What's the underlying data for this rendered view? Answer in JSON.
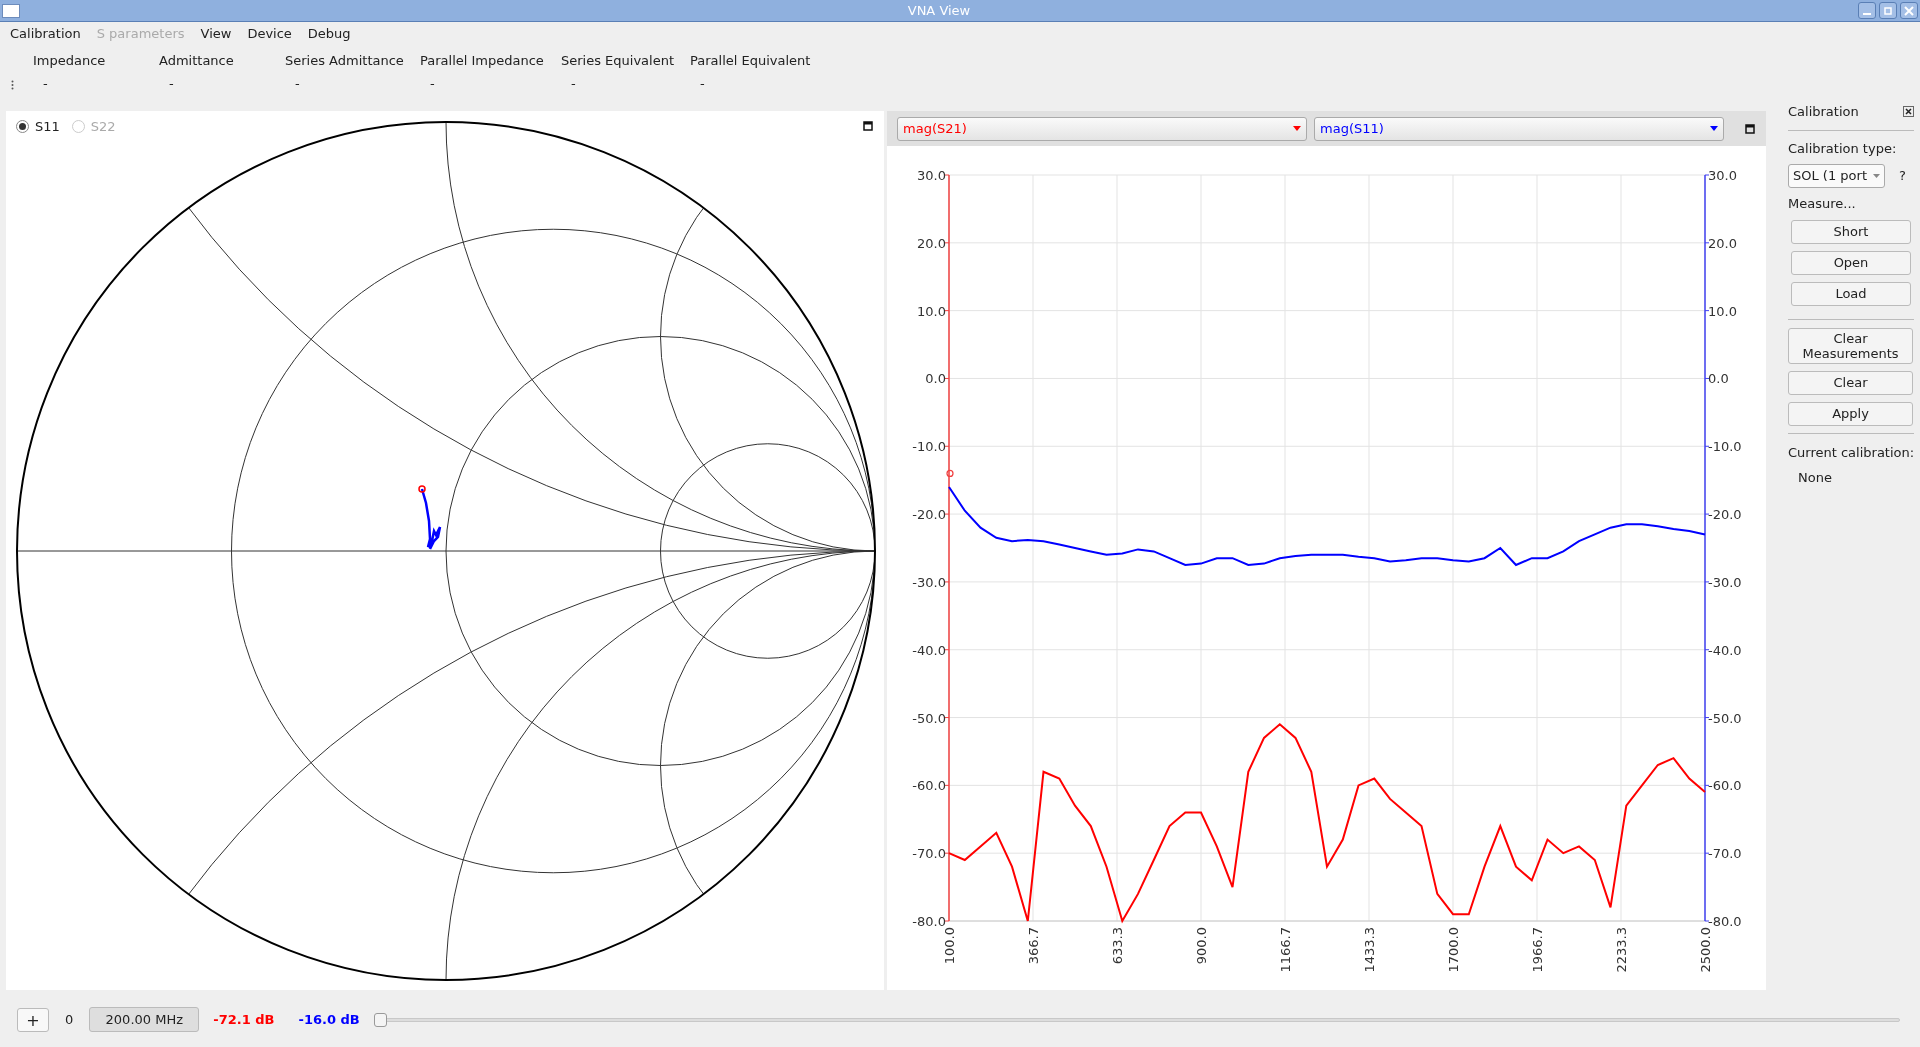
{
  "window": {
    "title": "VNA View"
  },
  "menu": [
    {
      "label": "Calibration",
      "disabled": false
    },
    {
      "label": "S parameters",
      "disabled": true
    },
    {
      "label": "View",
      "disabled": false
    },
    {
      "label": "Device",
      "disabled": false
    },
    {
      "label": "Debug",
      "disabled": false
    }
  ],
  "info_panel": {
    "columns": [
      {
        "heading": "Impedance",
        "value": "-"
      },
      {
        "heading": "Admittance",
        "value": "-"
      },
      {
        "heading": "Series Admittance",
        "value": "-"
      },
      {
        "heading": "Parallel Impedance",
        "value": "-"
      },
      {
        "heading": "Series Equivalent",
        "value": "-"
      },
      {
        "heading": "Parallel Equivalent",
        "value": "-"
      }
    ]
  },
  "smith_chart": {
    "ports": [
      {
        "label": "S11",
        "selected": true,
        "disabled": false
      },
      {
        "label": "S22",
        "selected": false,
        "disabled": true
      }
    ]
  },
  "graph": {
    "chart_data": {
      "type": "line",
      "grid": true,
      "x": [
        100,
        150,
        200,
        250,
        300,
        350,
        400,
        450,
        500,
        550,
        600,
        650,
        700,
        750,
        800,
        850,
        900,
        950,
        1000,
        1050,
        1100,
        1150,
        1200,
        1250,
        1300,
        1350,
        1400,
        1450,
        1500,
        1550,
        1600,
        1650,
        1700,
        1750,
        1800,
        1850,
        1900,
        1950,
        2000,
        2050,
        2100,
        2150,
        2200,
        2250,
        2300,
        2350,
        2400,
        2450,
        2500
      ],
      "series": [
        {
          "name": "mag(S21)",
          "color": "#ff0000",
          "values": [
            -70,
            -71,
            -69,
            -67,
            -72,
            -80,
            -58,
            -59,
            -63,
            -66,
            -72,
            -80,
            -76,
            -71,
            -66,
            -64,
            -64,
            -69,
            -75,
            -58,
            -53,
            -51,
            -53,
            -58,
            -72,
            -68,
            -60,
            -59,
            -62,
            -64,
            -66,
            -76,
            -79,
            -79,
            -72,
            -66,
            -72,
            -74,
            -68,
            -70,
            -69,
            -71,
            -78,
            -63,
            -60,
            -57,
            -56,
            -59,
            -61
          ]
        },
        {
          "name": "mag(S11)",
          "color": "#0000ff",
          "values": [
            -16,
            -19.5,
            -22,
            -23.5,
            -24,
            -23.8,
            -24,
            -24.5,
            -25,
            -25.5,
            -26,
            -25.8,
            -25.2,
            -25.5,
            -26.5,
            -27.5,
            -27.3,
            -26.5,
            -26.5,
            -27.5,
            -27.3,
            -26.5,
            -26.2,
            -26,
            -26,
            -26,
            -26.3,
            -26.5,
            -27,
            -26.8,
            -26.5,
            -26.5,
            -26.8,
            -27,
            -26.5,
            -25,
            -27.5,
            -26.5,
            -26.5,
            -25.5,
            -24,
            -23,
            -22,
            -21.5,
            -21.5,
            -21.8,
            -22.2,
            -22.5,
            -23
          ]
        }
      ],
      "xlim": [
        100,
        2500
      ],
      "ylim": [
        -80,
        30
      ],
      "xticks": [
        {
          "value": 100,
          "label": "100.0"
        },
        {
          "value": 366.7,
          "label": "366.7"
        },
        {
          "value": 633.3,
          "label": "633.3"
        },
        {
          "value": 900,
          "label": "900.0"
        },
        {
          "value": 1166.7,
          "label": "1166.7"
        },
        {
          "value": 1433.3,
          "label": "1433.3"
        },
        {
          "value": 1700,
          "label": "1700.0"
        },
        {
          "value": 1966.7,
          "label": "1966.7"
        },
        {
          "value": 2233.3,
          "label": "2233.3"
        },
        {
          "value": 2500,
          "label": "2500.0"
        }
      ],
      "yticks": [
        {
          "value": 30,
          "label": "30.0"
        },
        {
          "value": 20,
          "label": "20.0"
        },
        {
          "value": 10,
          "label": "10.0"
        },
        {
          "value": 0,
          "label": "0.0"
        },
        {
          "value": -10,
          "label": "-10.0"
        },
        {
          "value": -20,
          "label": "-20.0"
        },
        {
          "value": -30,
          "label": "-30.0"
        },
        {
          "value": -40,
          "label": "-40.0"
        },
        {
          "value": -50,
          "label": "-50.0"
        },
        {
          "value": -60,
          "label": "-60.0"
        },
        {
          "value": -70,
          "label": "-70.0"
        },
        {
          "value": -80,
          "label": "-80.0"
        }
      ]
    }
  },
  "calibration_dock": {
    "title": "Calibration",
    "type_label": "Calibration type:",
    "type_value": "SOL (1 port",
    "help": "?",
    "measure_label": "Measure...",
    "measure_buttons": [
      "Short",
      "Open",
      "Load"
    ],
    "action_buttons": [
      "Clear Measurements",
      "Clear",
      "Apply"
    ],
    "current_label": "Current calibration:",
    "current_value": "None"
  },
  "bottom_bar": {
    "add_button": "+",
    "marker_index": "0",
    "frequency": "200.00 MHz",
    "readings": [
      {
        "text": "-72.1 dB",
        "color": "#ff0000"
      },
      {
        "text": "-16.0 dB",
        "color": "#0000ff"
      }
    ],
    "slider": {
      "level": 0
    }
  }
}
